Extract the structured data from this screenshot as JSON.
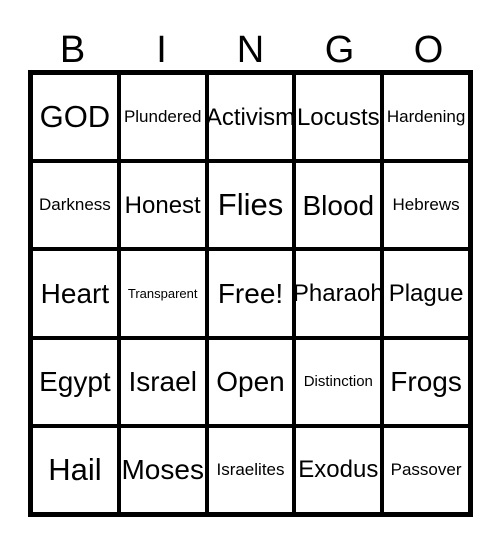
{
  "card": {
    "type": "bingo-card",
    "columns": 5,
    "rows": 5,
    "border_color": "#000000",
    "background_color": "#ffffff",
    "text_color": "#000000",
    "header_letters": [
      "B",
      "I",
      "N",
      "G",
      "O"
    ],
    "free_space": {
      "row": 2,
      "column": 2,
      "label": "Free!"
    },
    "grid": [
      [
        {
          "label": "GOD",
          "size": "xl"
        },
        {
          "label": "Plundered",
          "size": "sm"
        },
        {
          "label": "Activism",
          "size": "md"
        },
        {
          "label": "Locusts",
          "size": "md"
        },
        {
          "label": "Hardening",
          "size": "sm"
        }
      ],
      [
        {
          "label": "Darkness",
          "size": "sm"
        },
        {
          "label": "Honest",
          "size": "md"
        },
        {
          "label": "Flies",
          "size": "xl"
        },
        {
          "label": "Blood",
          "size": "lg"
        },
        {
          "label": "Hebrews",
          "size": "sm"
        }
      ],
      [
        {
          "label": "Heart",
          "size": "lg"
        },
        {
          "label": "Transparent",
          "size": "xxs"
        },
        {
          "label": "Free!",
          "size": "lg"
        },
        {
          "label": "Pharaoh",
          "size": "md"
        },
        {
          "label": "Plague",
          "size": "md"
        }
      ],
      [
        {
          "label": "Egypt",
          "size": "lg"
        },
        {
          "label": "Israel",
          "size": "lg"
        },
        {
          "label": "Open",
          "size": "lg"
        },
        {
          "label": "Distinction",
          "size": "xs"
        },
        {
          "label": "Frogs",
          "size": "lg"
        }
      ],
      [
        {
          "label": "Hail",
          "size": "xl"
        },
        {
          "label": "Moses",
          "size": "lg"
        },
        {
          "label": "Israelites",
          "size": "sm"
        },
        {
          "label": "Exodus",
          "size": "md"
        },
        {
          "label": "Passover",
          "size": "sm"
        }
      ]
    ]
  }
}
